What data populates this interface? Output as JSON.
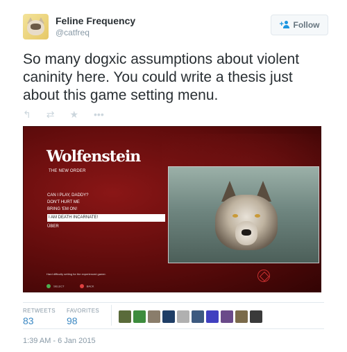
{
  "account": {
    "name": "Feline Frequency",
    "handle": "@catfreq"
  },
  "follow_button": {
    "label": "Follow"
  },
  "tweet": {
    "text": "So many dogxic assumptions about violent caninity here. You could write a thesis just about this game setting menu."
  },
  "actions": [
    {
      "icon": "reply-icon",
      "glyph": "↰"
    },
    {
      "icon": "retweet-icon",
      "glyph": "⇄"
    },
    {
      "icon": "favorite-icon",
      "glyph": "★"
    },
    {
      "icon": "more-icon",
      "glyph": "•••"
    }
  ],
  "game_screen": {
    "title": "Wolfenstein",
    "subtitle": "THE NEW ORDER",
    "menu": [
      "CAN I PLAY, DADDY?",
      "DON'T HURT ME",
      "BRING 'EM ON!",
      "I AM DEATH INCARNATE!",
      "ÜBER"
    ],
    "selected_index": 3,
    "hint": "Hard difficulty setting for the experienced gamer.",
    "select_label": "SELECT",
    "back_label": "BACK"
  },
  "stats": {
    "retweets_label": "RETWEETS",
    "retweets_count": "83",
    "favorites_label": "FAVORITES",
    "favorites_count": "98"
  },
  "favoriters": [
    "#5a6b3a",
    "#3d8c3d",
    "#8a7d6b",
    "#1f3e66",
    "#b0b0b0",
    "#3d5a80",
    "#4040c0",
    "#6a4a8a",
    "#7a6a4a",
    "#3a3a3a"
  ],
  "timestamp": "1:39 AM - 6 Jan 2015",
  "colors": {
    "accent": "#1b95e0",
    "count": "#3b88c3",
    "muted": "#8899a6"
  }
}
